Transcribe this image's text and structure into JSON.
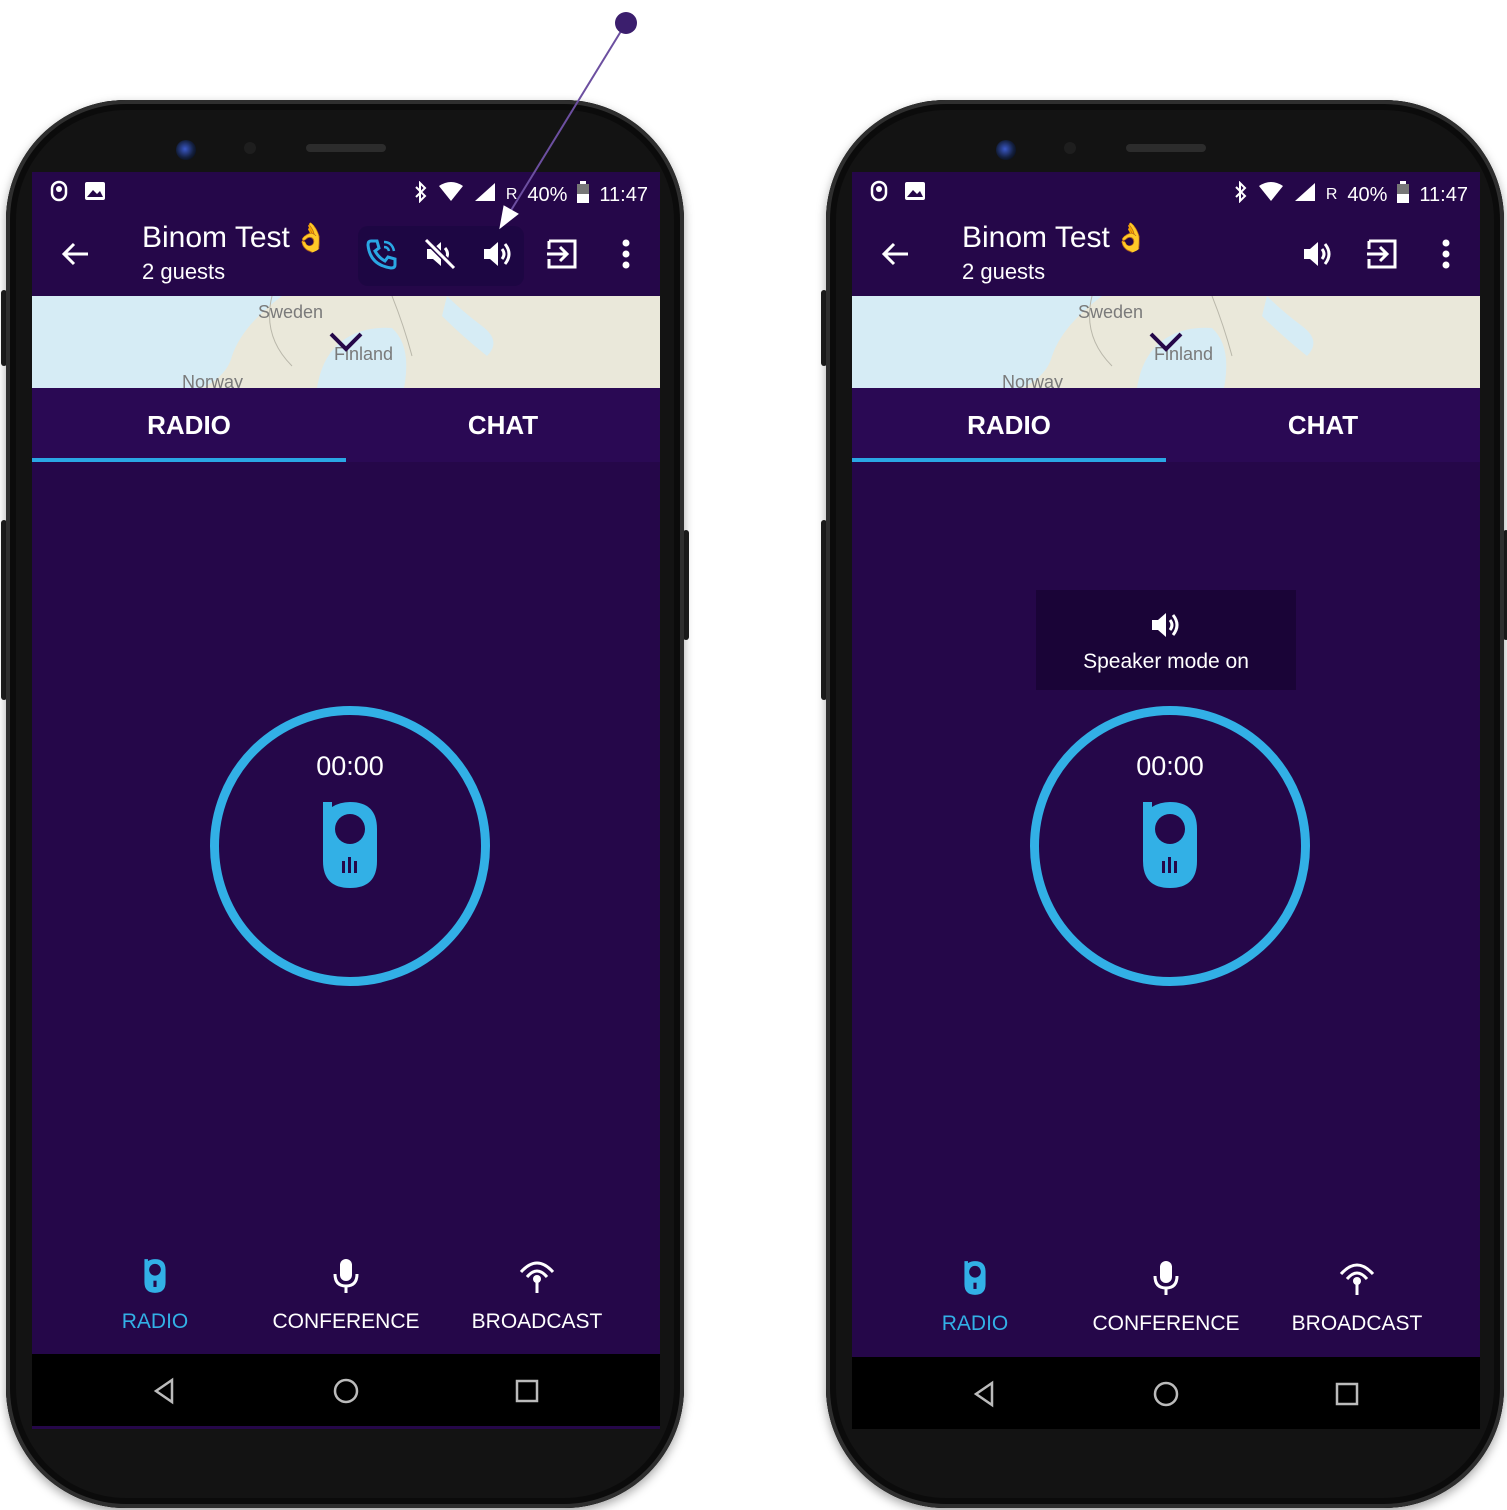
{
  "status_bar": {
    "battery": "40%",
    "time": "11:47",
    "roaming": "R"
  },
  "app_bar": {
    "title": "Binom Test",
    "subtitle": "2 guests"
  },
  "map": {
    "labels": [
      "Sweden",
      "Finland",
      "Norway"
    ]
  },
  "tabs": [
    "RADIO",
    "CHAT"
  ],
  "ptt": {
    "timer": "00:00"
  },
  "toast": {
    "text": "Speaker mode on"
  },
  "bottom_nav": [
    "RADIO",
    "CONFERENCE",
    "BROADCAST"
  ],
  "colors": {
    "background": "#250749",
    "tab_bar": "#2a0954",
    "accent": "#32b0e6",
    "annotation": "#3b1e6d"
  }
}
